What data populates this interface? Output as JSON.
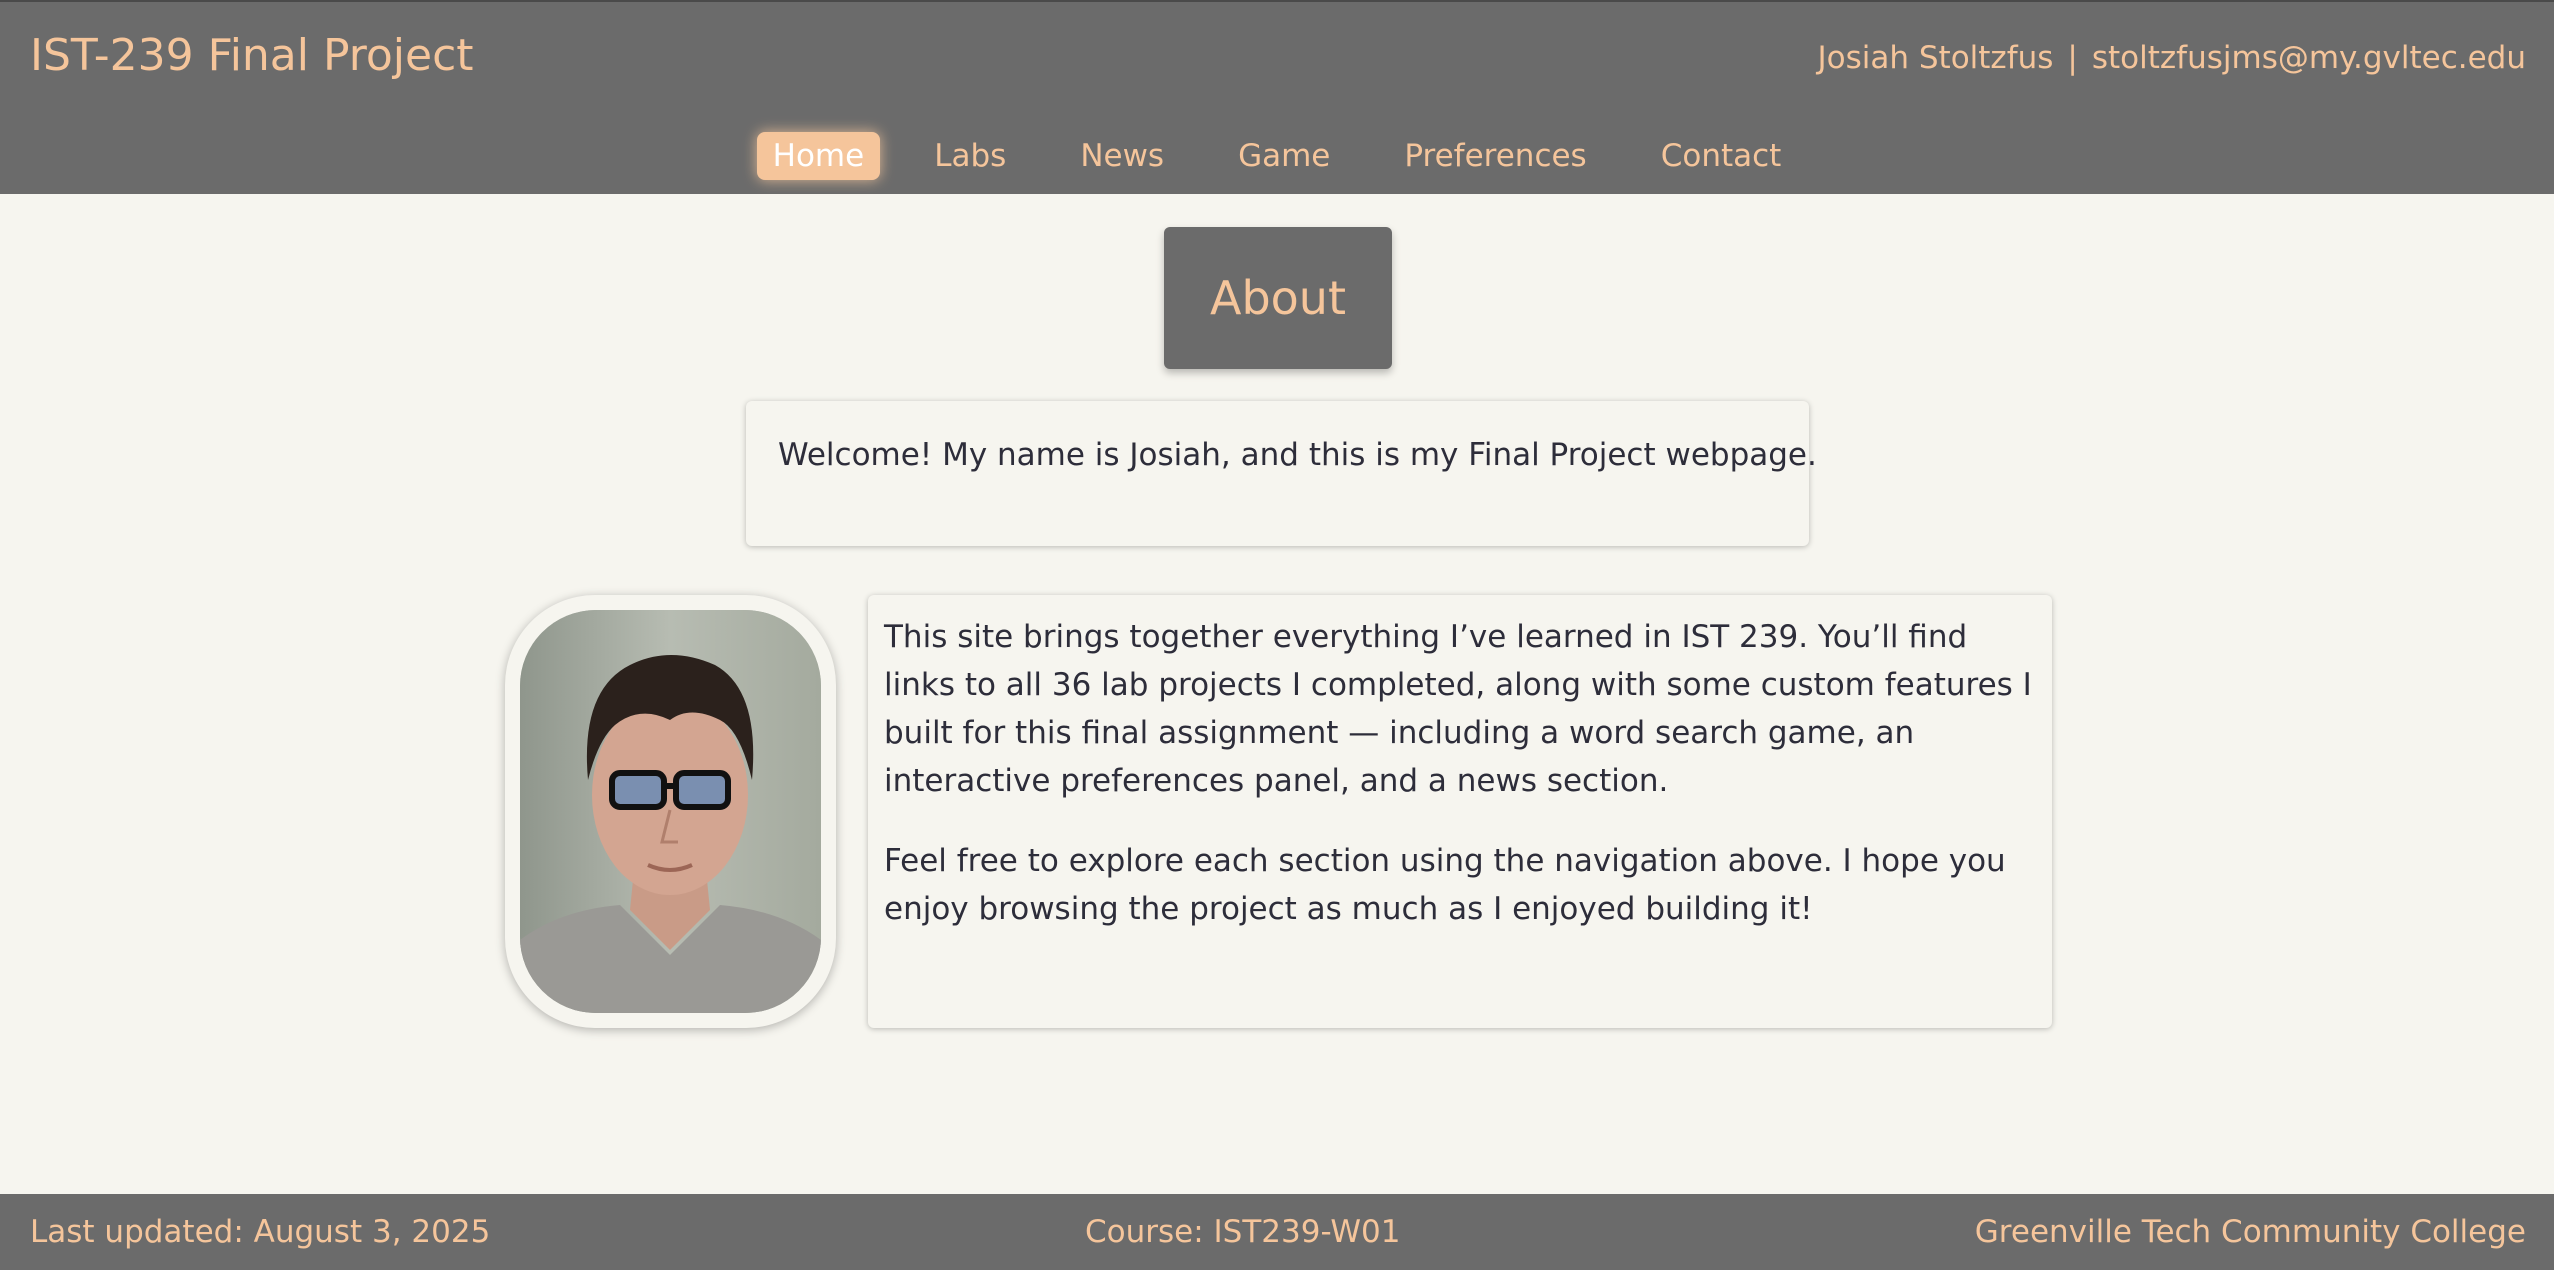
{
  "header": {
    "site_title": "IST-239 Final Project",
    "author_name": "Josiah Stoltzfus",
    "separator": "|",
    "author_email": "stoltzfusjms@my.gvltec.edu"
  },
  "nav": {
    "items": [
      {
        "label": "Home",
        "active": true
      },
      {
        "label": "Labs",
        "active": false
      },
      {
        "label": "News",
        "active": false
      },
      {
        "label": "Game",
        "active": false
      },
      {
        "label": "Preferences",
        "active": false
      },
      {
        "label": "Contact",
        "active": false
      }
    ]
  },
  "main": {
    "section_title": "About",
    "welcome_text": "Welcome! My name is Josiah, and this is my Final Project webpage.",
    "bio_paragraphs": [
      "This site brings together everything I’ve learned in IST 239. You’ll find links to all 36 lab projects I completed, along with some custom features I built for this final assignment — including a word search game, an interactive preferences panel, and a news section.",
      "Feel free to explore each section using the navigation above. I hope you enjoy browsing the project as much as I enjoyed building it!"
    ]
  },
  "footer": {
    "last_updated": "Last updated: August 3, 2025",
    "course": "Course: IST239-W01",
    "institution": "Greenville Tech Community College"
  },
  "colors": {
    "header_bg": "#6b6b6b",
    "accent": "#f5c59b",
    "page_bg": "#f6f5ef",
    "body_text": "#2d2d3a"
  }
}
